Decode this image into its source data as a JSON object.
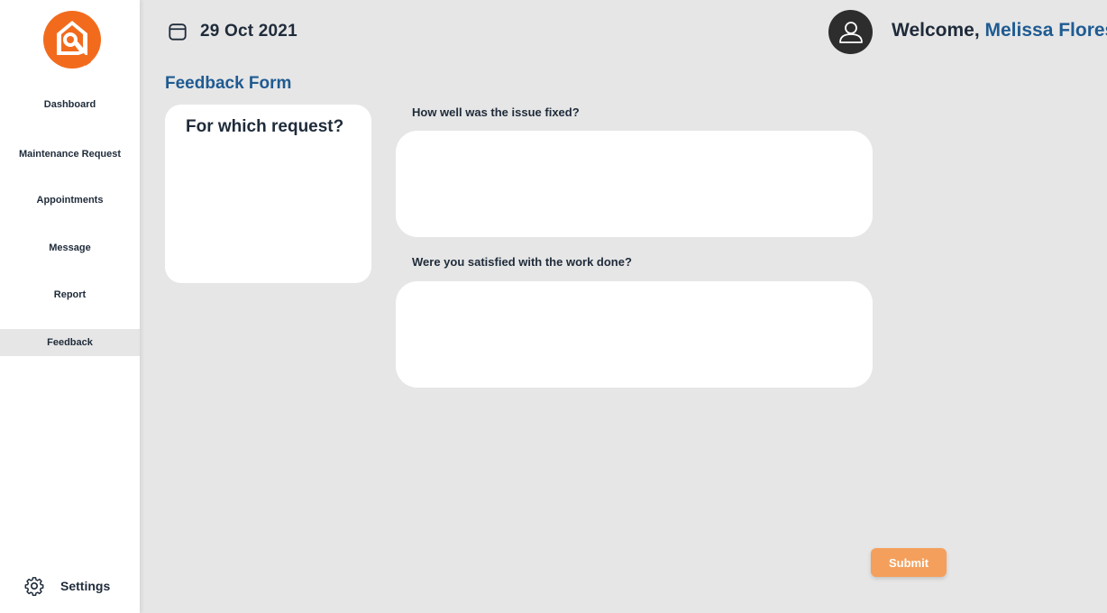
{
  "brand": {
    "accent": "#f26b1d",
    "primary": "#1f5b92",
    "button": "#f4a05c"
  },
  "sidebar": {
    "items": [
      {
        "label": "Dashboard"
      },
      {
        "label": "Maintenance Request"
      },
      {
        "label": "Appointments"
      },
      {
        "label": "Message"
      },
      {
        "label": "Report"
      },
      {
        "label": "Feedback",
        "active": true
      }
    ],
    "settings_label": "Settings",
    "settings_icon": "gear-icon"
  },
  "header": {
    "date": "29 Oct 2021",
    "date_icon": "calendar-icon",
    "welcome": "Welcome,",
    "user_name": "Melissa Flores",
    "avatar_icon": "user-icon"
  },
  "form": {
    "title": "Feedback Form",
    "request_title": "For which request?",
    "question1": "How well was the issue fixed?",
    "question1_value": "",
    "question2": "Were you satisfied with the work done?",
    "question2_value": "",
    "submit_label": "Submit"
  }
}
